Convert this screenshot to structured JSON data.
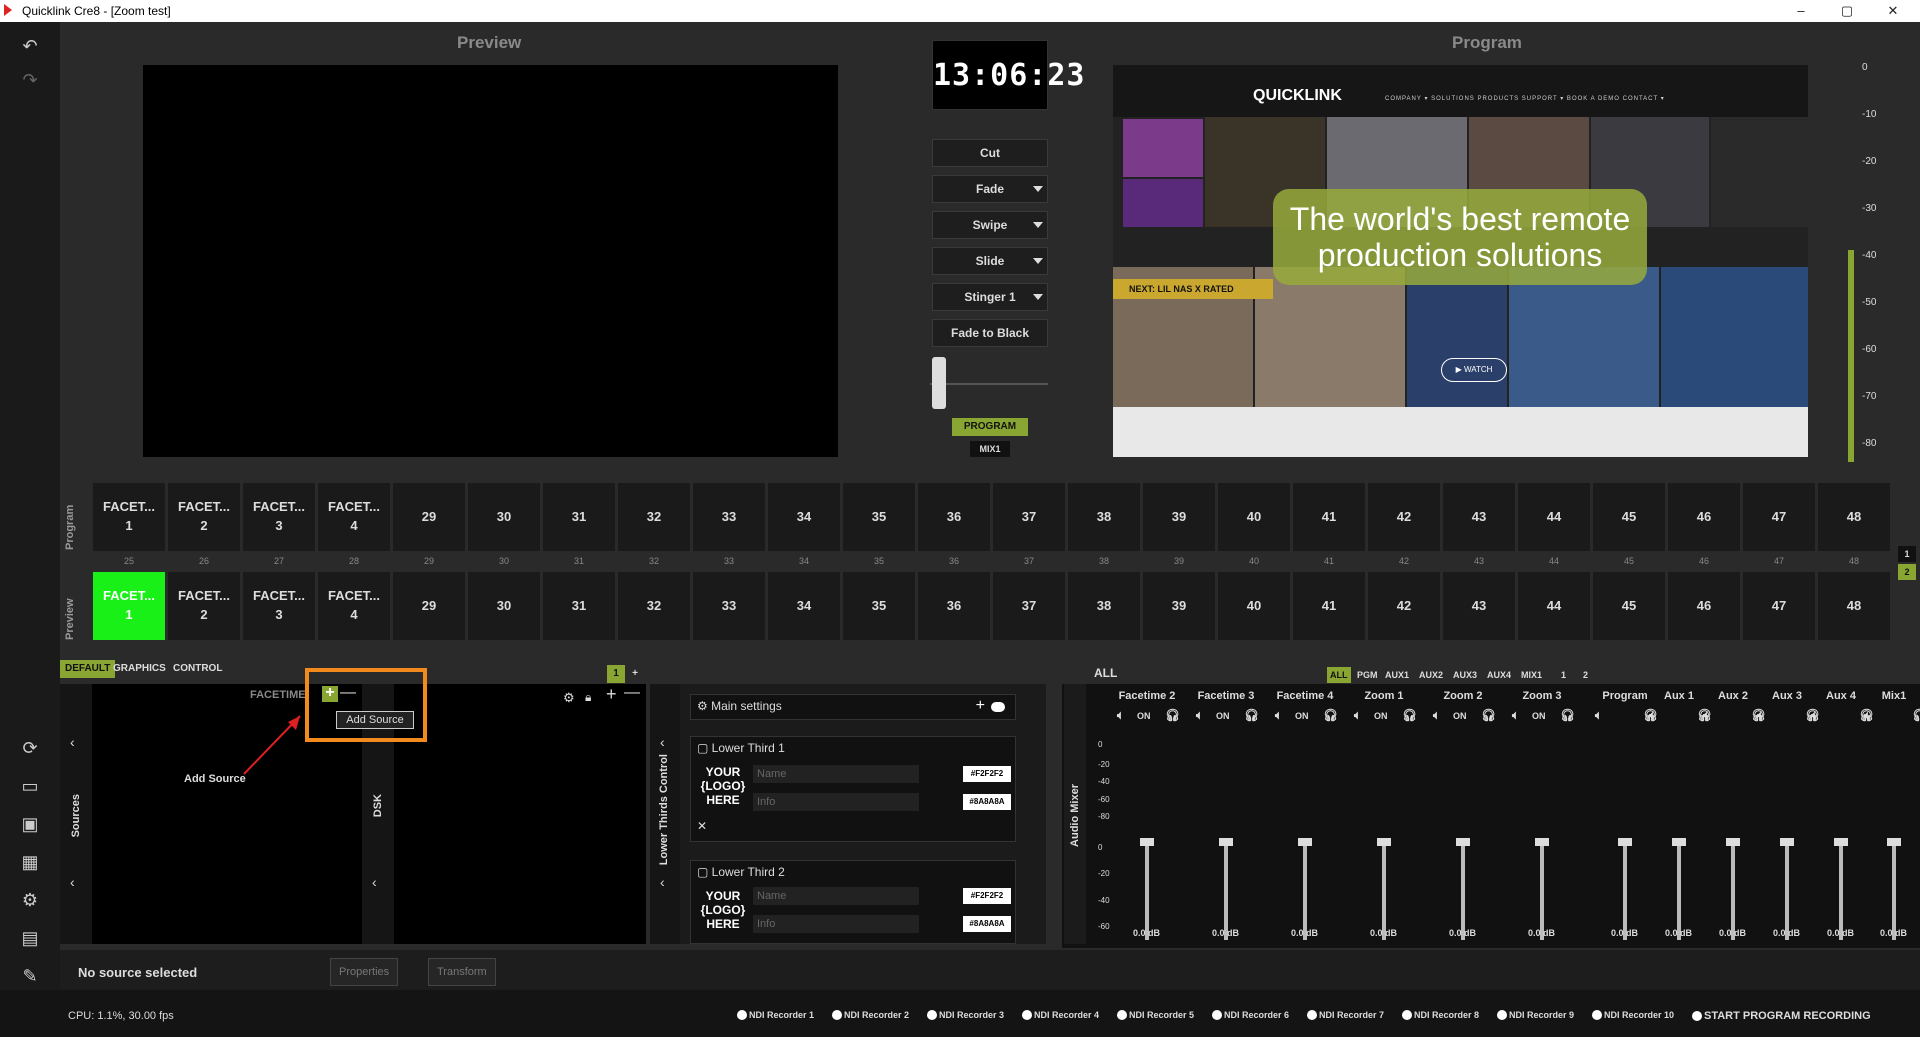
{
  "window": {
    "title": "Quicklink Cre8 - [Zoom test]",
    "min": "–",
    "max": "▢",
    "close": "✕"
  },
  "leftbar": {
    "undo": "↶",
    "redo": "↷",
    "icons": [
      "⟳",
      "▭",
      "▣",
      "▦",
      "⚙",
      "▤",
      "✎",
      "➜"
    ]
  },
  "headers": {
    "preview": "Preview",
    "program": "Program"
  },
  "clock": "13:06:23",
  "transitions": {
    "cut": "Cut",
    "fade": "Fade",
    "swipe": "Swipe",
    "slide": "Slide",
    "stinger": "Stinger 1",
    "ftb": "Fade to Black"
  },
  "badges": {
    "program": "PROGRAM",
    "mix": "MIX1"
  },
  "program_web": {
    "logo": "QUICKLINK",
    "nav": "COMPANY ▾   SOLUTIONS   PRODUCTS   SUPPORT ▾   BOOK A DEMO   CONTACT ▾",
    "headline": "The world's best remote production solutions",
    "next": "NEXT: LIL NAS X RATED",
    "watch": "▶ WATCH"
  },
  "vu_ticks": [
    "0",
    "-10",
    "-20",
    "-30",
    "-40",
    "-50",
    "-60",
    "-70",
    "-80"
  ],
  "row_labels": {
    "program": "Program",
    "preview": "Preview"
  },
  "program_sources": [
    {
      "l1": "FACET...",
      "l2": "1"
    },
    {
      "l1": "FACET...",
      "l2": "2"
    },
    {
      "l1": "FACET...",
      "l2": "3"
    },
    {
      "l1": "FACET...",
      "l2": "4"
    },
    {
      "only": "29"
    },
    {
      "only": "30"
    },
    {
      "only": "31"
    },
    {
      "only": "32"
    },
    {
      "only": "33"
    },
    {
      "only": "34"
    },
    {
      "only": "35"
    },
    {
      "only": "36"
    },
    {
      "only": "37"
    },
    {
      "only": "38"
    },
    {
      "only": "39"
    },
    {
      "only": "40"
    },
    {
      "only": "41"
    },
    {
      "only": "42"
    },
    {
      "only": "43"
    },
    {
      "only": "44"
    },
    {
      "only": "45"
    },
    {
      "only": "46"
    },
    {
      "only": "47"
    },
    {
      "only": "48"
    }
  ],
  "source_numbers": [
    "25",
    "26",
    "27",
    "28",
    "29",
    "30",
    "31",
    "32",
    "33",
    "34",
    "35",
    "36",
    "37",
    "38",
    "39",
    "40",
    "41",
    "42",
    "43",
    "44",
    "45",
    "46",
    "47",
    "48"
  ],
  "preview_sources": [
    {
      "l1": "FACET...",
      "l2": "1"
    },
    {
      "l1": "FACET...",
      "l2": "2"
    },
    {
      "l1": "FACET...",
      "l2": "3"
    },
    {
      "l1": "FACET...",
      "l2": "4"
    },
    {
      "only": "29"
    },
    {
      "only": "30"
    },
    {
      "only": "31"
    },
    {
      "only": "32"
    },
    {
      "only": "33"
    },
    {
      "only": "34"
    },
    {
      "only": "35"
    },
    {
      "only": "36"
    },
    {
      "only": "37"
    },
    {
      "only": "38"
    },
    {
      "only": "39"
    },
    {
      "only": "40"
    },
    {
      "only": "41"
    },
    {
      "only": "42"
    },
    {
      "only": "43"
    },
    {
      "only": "44"
    },
    {
      "only": "45"
    },
    {
      "only": "46"
    },
    {
      "only": "47"
    },
    {
      "only": "48"
    }
  ],
  "pages": [
    "1",
    "2"
  ],
  "tabs": {
    "default": "DEFAULT",
    "graphics": "GRAPHICS",
    "control": "CONTROL"
  },
  "scene_tabs": {
    "one": "1",
    "plus": "+"
  },
  "scene": {
    "name": "FACETIME",
    "add": "+",
    "remove": "—",
    "tooltip": "Add Source",
    "annotation": "Add Source"
  },
  "strips": {
    "sources": "Sources",
    "dsk": "DSK",
    "lt": "Lower Thirds Control",
    "audio": "Audio Mixer"
  },
  "lower_thirds": {
    "main": "Main settings",
    "items": [
      {
        "title": "Lower Third 1",
        "name_ph": "Name",
        "info_ph": "Info",
        "color1": "#F2F2F2",
        "color2": "#8A8A8A",
        "logo": "YOUR\n{LOGO}\nHERE"
      },
      {
        "title": "Lower Third 2",
        "name_ph": "Name",
        "info_ph": "Info",
        "color1": "#F2F2F2",
        "color2": "#8A8A8A",
        "logo": "YOUR\n{LOGO}\nHERE"
      }
    ]
  },
  "audio": {
    "all": "ALL",
    "tabs": [
      "ALL",
      "PGM",
      "AUX1",
      "AUX2",
      "AUX3",
      "AUX4",
      "MIX1",
      "1",
      "2"
    ],
    "channels": [
      "Facetime 2",
      "Facetime 3",
      "Facetime 4",
      "Zoom 1",
      "Zoom 2",
      "Zoom 3",
      "Program",
      "Aux 1",
      "Aux 2",
      "Aux 3",
      "Aux 4",
      "Mix1"
    ],
    "on": "ON",
    "db": "0.0 dB",
    "scale": [
      "0",
      "-20",
      "-40",
      "-60",
      "-80",
      "0",
      "-20",
      "-40",
      "-60"
    ]
  },
  "status": {
    "no_source": "No source selected",
    "properties": "Properties",
    "transform": "Transform"
  },
  "bottom": {
    "cpu": "CPU: 1.1%, 30.00 fps",
    "recorders": [
      "NDI Recorder 1",
      "NDI Recorder 2",
      "NDI Recorder 3",
      "NDI Recorder 4",
      "NDI Recorder 5",
      "NDI Recorder 6",
      "NDI Recorder 7",
      "NDI Recorder 8",
      "NDI Recorder 9",
      "NDI Recorder 10",
      "START PROGRAM RECORDING"
    ]
  },
  "colors": {
    "accent": "#8aa632",
    "preview_active": "#18f018",
    "highlight": "#f38a1d"
  }
}
